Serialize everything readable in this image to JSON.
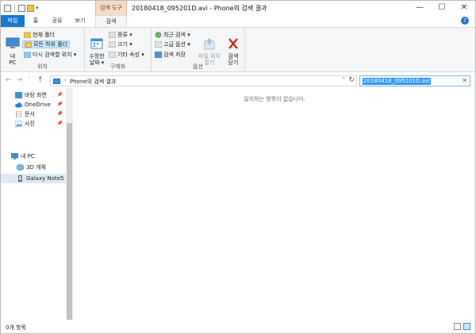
{
  "window": {
    "title": "20180418_095201D.avi - Phone의 검색 결과",
    "context_tab_group": "검색 도구",
    "controls": {
      "minimize": "—",
      "maximize": "☐",
      "close": "✕"
    }
  },
  "quick_access": {
    "dropdown": "▾"
  },
  "tabs": [
    {
      "label": "파일"
    },
    {
      "label": "홈"
    },
    {
      "label": "공유"
    },
    {
      "label": "보기"
    },
    {
      "label": "검색"
    }
  ],
  "help": "?",
  "ribbon": {
    "location": {
      "label": "위치",
      "my_pc": "내\nPC",
      "current_folder": "현재 폴더",
      "all_subfolders": "모든 하위 폴더",
      "search_again": "다시 검색할 위치 ▾"
    },
    "refine": {
      "label": "구체화",
      "date_modified": "수정한\n날짜 ▾",
      "kind": "종류 ▾",
      "size": "크기 ▾",
      "other_props": "기타 속성 ▾"
    },
    "options": {
      "label": "옵션",
      "recent_searches": "최근 검색 ▾",
      "advanced_options": "고급 옵션 ▾",
      "save_search": "검색 저장",
      "open_location": "파일 위치\n열기",
      "close_search": "검색\n닫기"
    }
  },
  "nav": {
    "back": "←",
    "forward": "→",
    "dropdown": "˅",
    "up": "↑"
  },
  "address": {
    "chevron": "›",
    "path": "Phone의 검색 결과",
    "dropdown": "˅",
    "refresh": "↻"
  },
  "search": {
    "value": "20180418_095201D.avi",
    "clear": "✕"
  },
  "navpane": {
    "pin": "📌",
    "quick": [
      {
        "label": "바탕 화면"
      },
      {
        "label": "OneDrive"
      },
      {
        "label": "문서"
      },
      {
        "label": "사진"
      }
    ],
    "pc": {
      "label": "내 PC"
    },
    "pc_children": [
      {
        "label": "3D 개체"
      },
      {
        "label": "Galaxy Note5"
      }
    ]
  },
  "content": {
    "empty_message": "일치하는 항목이 없습니다."
  },
  "status": {
    "count": "0개 항목"
  },
  "colors": {
    "accent": "#1979ca",
    "context_tab": "#f6dcc7",
    "selection": "#cde8ff",
    "close_red": "#c42b1c"
  }
}
